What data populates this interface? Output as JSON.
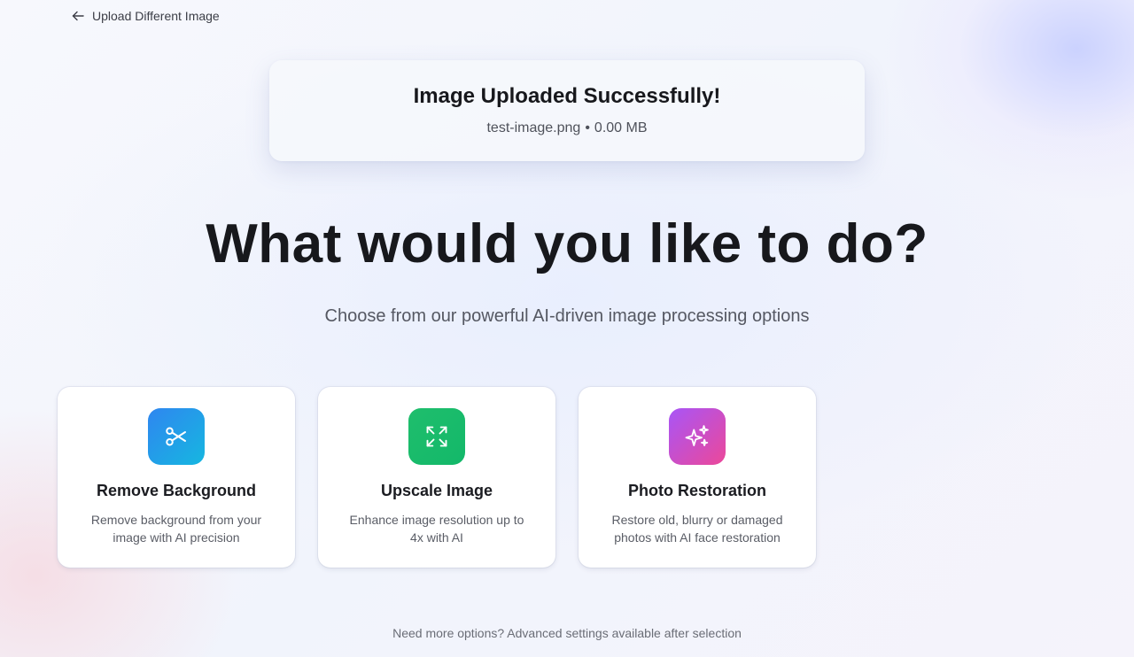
{
  "nav": {
    "back_label": "Upload Different Image",
    "back_icon": "arrow-left-icon"
  },
  "upload": {
    "title": "Image Uploaded Successfully!",
    "file_name": "test-image.png",
    "separator": "•",
    "file_size": "0.00 MB"
  },
  "main": {
    "headline": "What would you like to do?",
    "subheadline": "Choose from our powerful AI-driven image processing options"
  },
  "options": [
    {
      "title": "Remove Background",
      "description": "Remove background from your image with AI precision",
      "icon": "scissors-icon",
      "gradient": [
        "#2f86f0",
        "#16b7e0"
      ]
    },
    {
      "title": "Upscale Image",
      "description": "Enhance image resolution up to 4x with AI",
      "icon": "expand-icon",
      "gradient": [
        "#1fbe6c",
        "#13b86a"
      ]
    },
    {
      "title": "Photo Restoration",
      "description": "Restore old, blurry or damaged photos with AI face restoration",
      "icon": "sparkles-icon",
      "gradient": [
        "#a855f7",
        "#ec4899"
      ]
    }
  ],
  "footer": {
    "note": "Need more options? Advanced settings available after selection"
  }
}
